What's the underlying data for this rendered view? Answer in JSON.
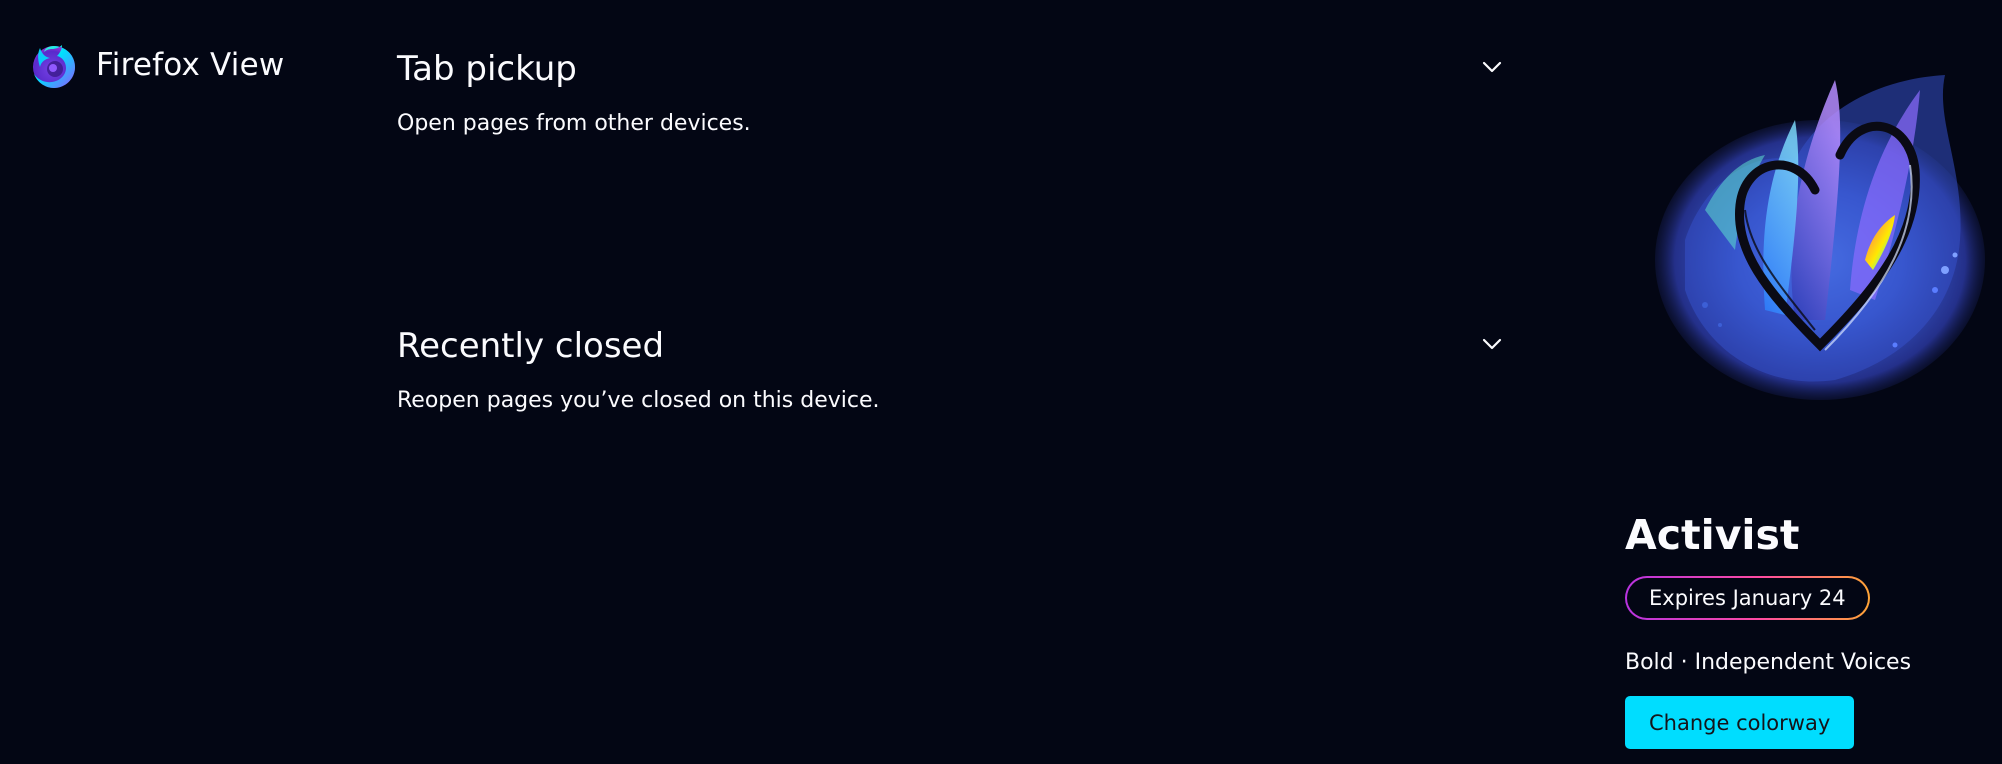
{
  "header": {
    "title": "Firefox View",
    "logo_icon": "firefox-logo-icon"
  },
  "sections": [
    {
      "title": "Tab pickup",
      "description": "Open pages from other devices.",
      "toggle_icon": "chevron-down-icon"
    },
    {
      "title": "Recently closed",
      "description": "Reopen pages you’ve closed on this device.",
      "toggle_icon": "chevron-down-icon"
    }
  ],
  "colorway": {
    "name": "Activist",
    "expires": "Expires January 24",
    "tagline": "Bold · Independent Voices",
    "button_label": "Change colorway",
    "illustration": "colorway-heart-illustration",
    "accent_color": "#00ddff",
    "background_color": "#030614"
  }
}
